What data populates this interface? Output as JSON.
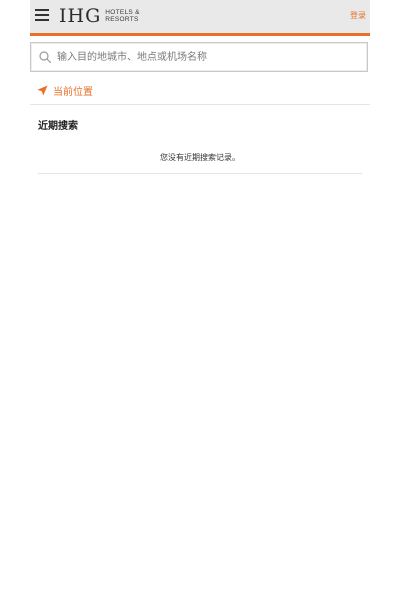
{
  "header": {
    "menu_icon": "hamburger-menu-icon",
    "logo_main": "IHG",
    "logo_sub_line1": "HOTELS &",
    "logo_sub_line2": "RESORTS",
    "login_label": "登录",
    "accent_color": "#e8702a"
  },
  "search": {
    "icon": "search-icon",
    "placeholder": "输入目的地城市、地点或机场名称",
    "value": ""
  },
  "location": {
    "icon": "location-arrow-icon",
    "label": "当前位置"
  },
  "recent": {
    "title": "近期搜索",
    "empty_message": "您没有近期搜索记录。"
  }
}
